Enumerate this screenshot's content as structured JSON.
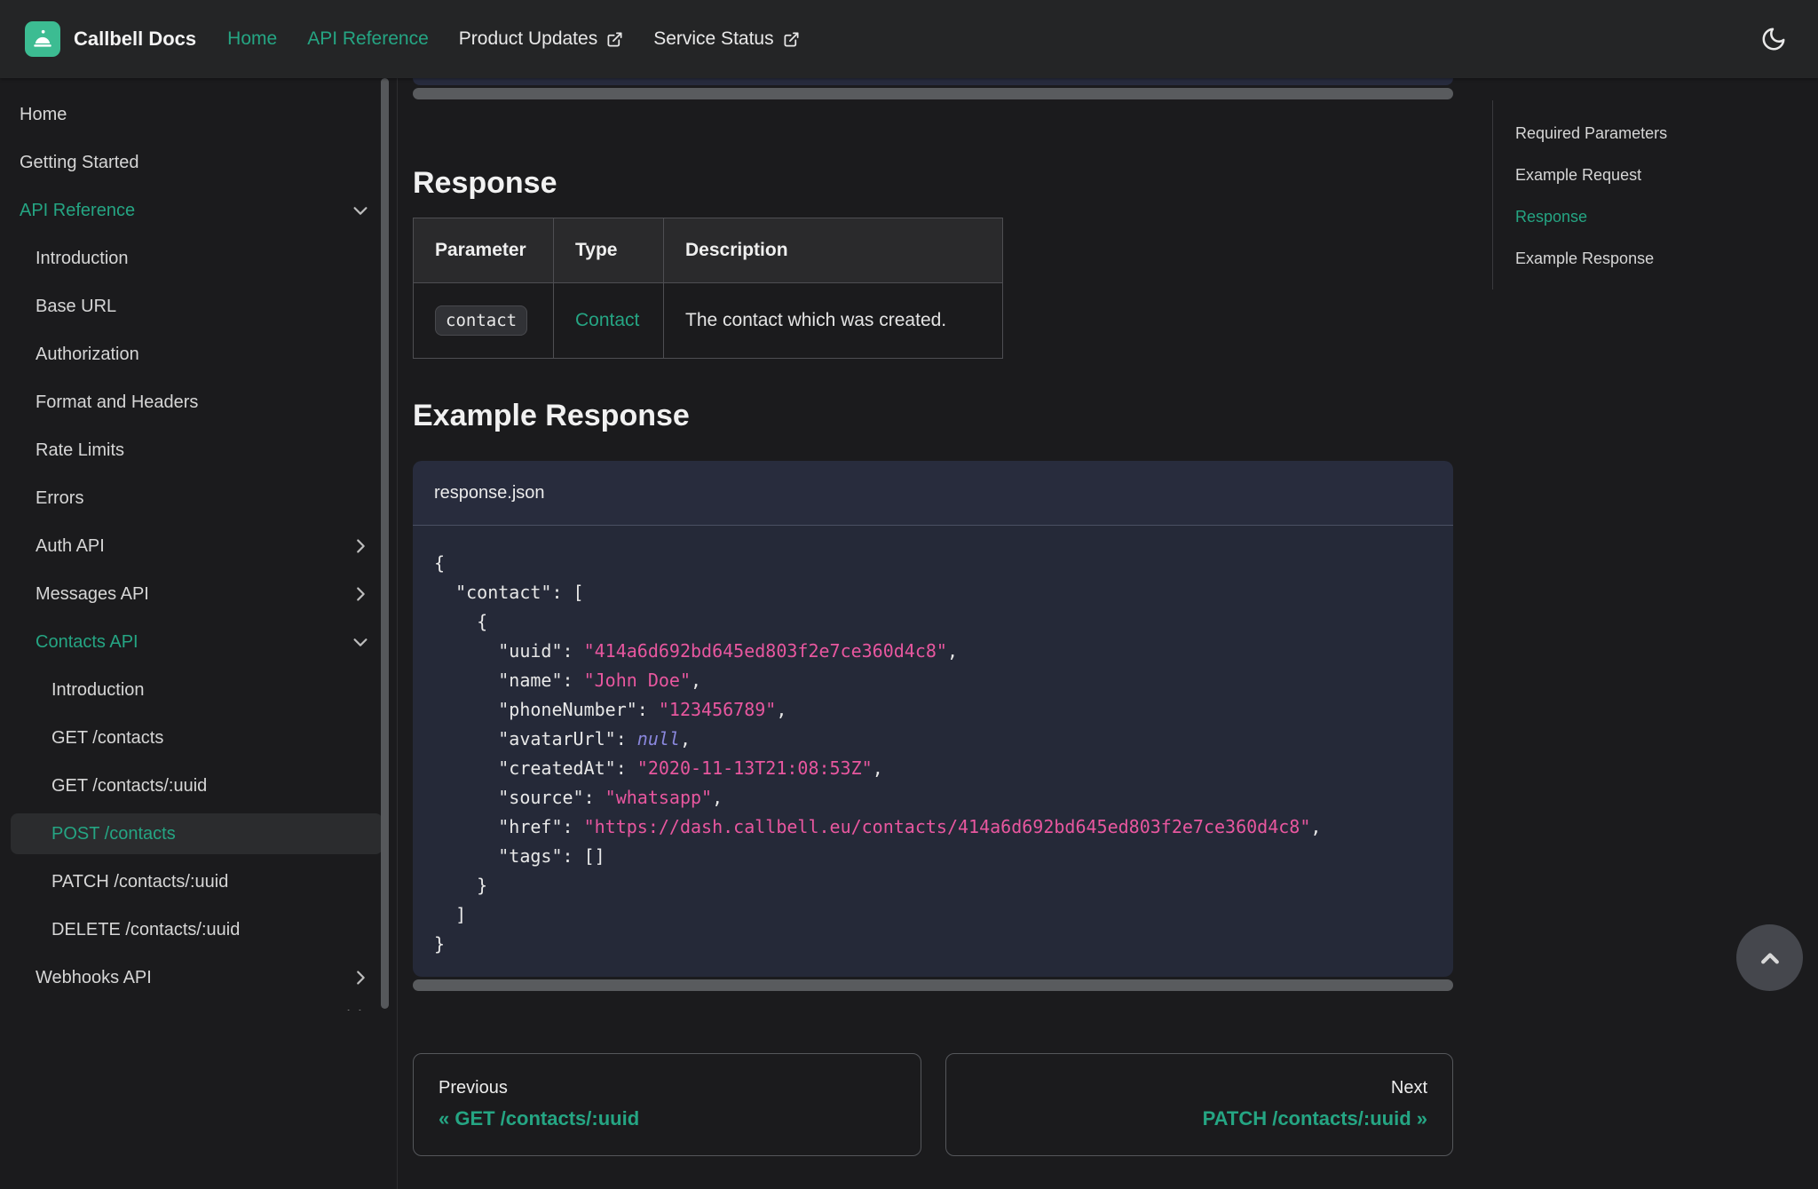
{
  "navbar": {
    "brand": "Callbell Docs",
    "links": [
      {
        "label": "Home",
        "active": true,
        "external": false
      },
      {
        "label": "API Reference",
        "active": true,
        "external": false
      },
      {
        "label": "Product Updates",
        "active": false,
        "external": true
      },
      {
        "label": "Service Status",
        "active": false,
        "external": true
      }
    ]
  },
  "sidebar": {
    "items": [
      {
        "label": "Home",
        "level": 0,
        "type": "link"
      },
      {
        "label": "Getting Started",
        "level": 0,
        "type": "link"
      },
      {
        "label": "API Reference",
        "level": 0,
        "type": "category",
        "expanded": true,
        "active": true
      },
      {
        "label": "Introduction",
        "level": 1,
        "type": "link"
      },
      {
        "label": "Base URL",
        "level": 1,
        "type": "link"
      },
      {
        "label": "Authorization",
        "level": 1,
        "type": "link"
      },
      {
        "label": "Format and Headers",
        "level": 1,
        "type": "link"
      },
      {
        "label": "Rate Limits",
        "level": 1,
        "type": "link"
      },
      {
        "label": "Errors",
        "level": 1,
        "type": "link"
      },
      {
        "label": "Auth API",
        "level": 1,
        "type": "category",
        "expanded": false,
        "active": false
      },
      {
        "label": "Messages API",
        "level": 1,
        "type": "category",
        "expanded": false,
        "active": false
      },
      {
        "label": "Contacts API",
        "level": 1,
        "type": "category",
        "expanded": true,
        "active": true
      },
      {
        "label": "Introduction",
        "level": 2,
        "type": "link"
      },
      {
        "label": "GET /contacts",
        "level": 2,
        "type": "link"
      },
      {
        "label": "GET /contacts/:uuid",
        "level": 2,
        "type": "link"
      },
      {
        "label": "POST /contacts",
        "level": 2,
        "type": "link",
        "current": true
      },
      {
        "label": "PATCH /contacts/:uuid",
        "level": 2,
        "type": "link"
      },
      {
        "label": "DELETE /contacts/:uuid",
        "level": 2,
        "type": "link"
      },
      {
        "label": "Webhooks API",
        "level": 1,
        "type": "category",
        "expanded": false,
        "active": false
      }
    ]
  },
  "toc": {
    "items": [
      {
        "label": "Required Parameters",
        "active": false
      },
      {
        "label": "Example Request",
        "active": false
      },
      {
        "label": "Response",
        "active": true
      },
      {
        "label": "Example Response",
        "active": false
      }
    ]
  },
  "main": {
    "response_heading": "Response",
    "example_response_heading": "Example Response",
    "table": {
      "headers": [
        "Parameter",
        "Type",
        "Description"
      ],
      "rows": [
        {
          "parameter": "contact",
          "type": "Contact",
          "description": "The contact which was created."
        }
      ]
    },
    "code": {
      "filename": "response.json",
      "lines": [
        [
          {
            "t": "{"
          }
        ],
        [
          {
            "t": "  \"contact\": ["
          }
        ],
        [
          {
            "t": "    {"
          }
        ],
        [
          {
            "t": "      \"uuid\": "
          },
          {
            "t": "\"414a6d692bd645ed803f2e7ce360d4c8\"",
            "c": "string"
          },
          {
            "t": ","
          }
        ],
        [
          {
            "t": "      \"name\": "
          },
          {
            "t": "\"John Doe\"",
            "c": "string"
          },
          {
            "t": ","
          }
        ],
        [
          {
            "t": "      \"phoneNumber\": "
          },
          {
            "t": "\"123456789\"",
            "c": "string"
          },
          {
            "t": ","
          }
        ],
        [
          {
            "t": "      \"avatarUrl\": "
          },
          {
            "t": "null",
            "c": "null"
          },
          {
            "t": ","
          }
        ],
        [
          {
            "t": "      \"createdAt\": "
          },
          {
            "t": "\"2020-11-13T21:08:53Z\"",
            "c": "string"
          },
          {
            "t": ","
          }
        ],
        [
          {
            "t": "      \"source\": "
          },
          {
            "t": "\"whatsapp\"",
            "c": "string"
          },
          {
            "t": ","
          }
        ],
        [
          {
            "t": "      \"href\": "
          },
          {
            "t": "\"https://dash.callbell.eu/contacts/414a6d692bd645ed803f2e7ce360d4c8\"",
            "c": "string"
          },
          {
            "t": ","
          }
        ],
        [
          {
            "t": "      \"tags\": []"
          }
        ],
        [
          {
            "t": "    }"
          }
        ],
        [
          {
            "t": "  ]"
          }
        ],
        [
          {
            "t": "}"
          }
        ]
      ]
    }
  },
  "pagination": {
    "previous_label": "Previous",
    "previous_link": "« GET /contacts/:uuid",
    "next_label": "Next",
    "next_link": "PATCH /contacts/:uuid »"
  },
  "icons": {
    "logo": "bell-icon",
    "theme_toggle": "moon-icon",
    "nav_external": "external-link-icon",
    "category_collapsed": "chevron-right-icon",
    "category_expanded": "chevron-down-icon",
    "scroll_top": "chevron-up-icon"
  },
  "colors": {
    "accent_green": "#25a583",
    "logo_green": "#3cbc92",
    "page_bg": "#1b1b1d",
    "navbar_bg": "#242526",
    "code_bg": "#252938",
    "code_header_bg": "#282c3d",
    "code_string": "#e8579f",
    "code_null": "#8a87dd",
    "table_header_bg": "#2a2a2c",
    "table_border": "#4e4e52"
  }
}
